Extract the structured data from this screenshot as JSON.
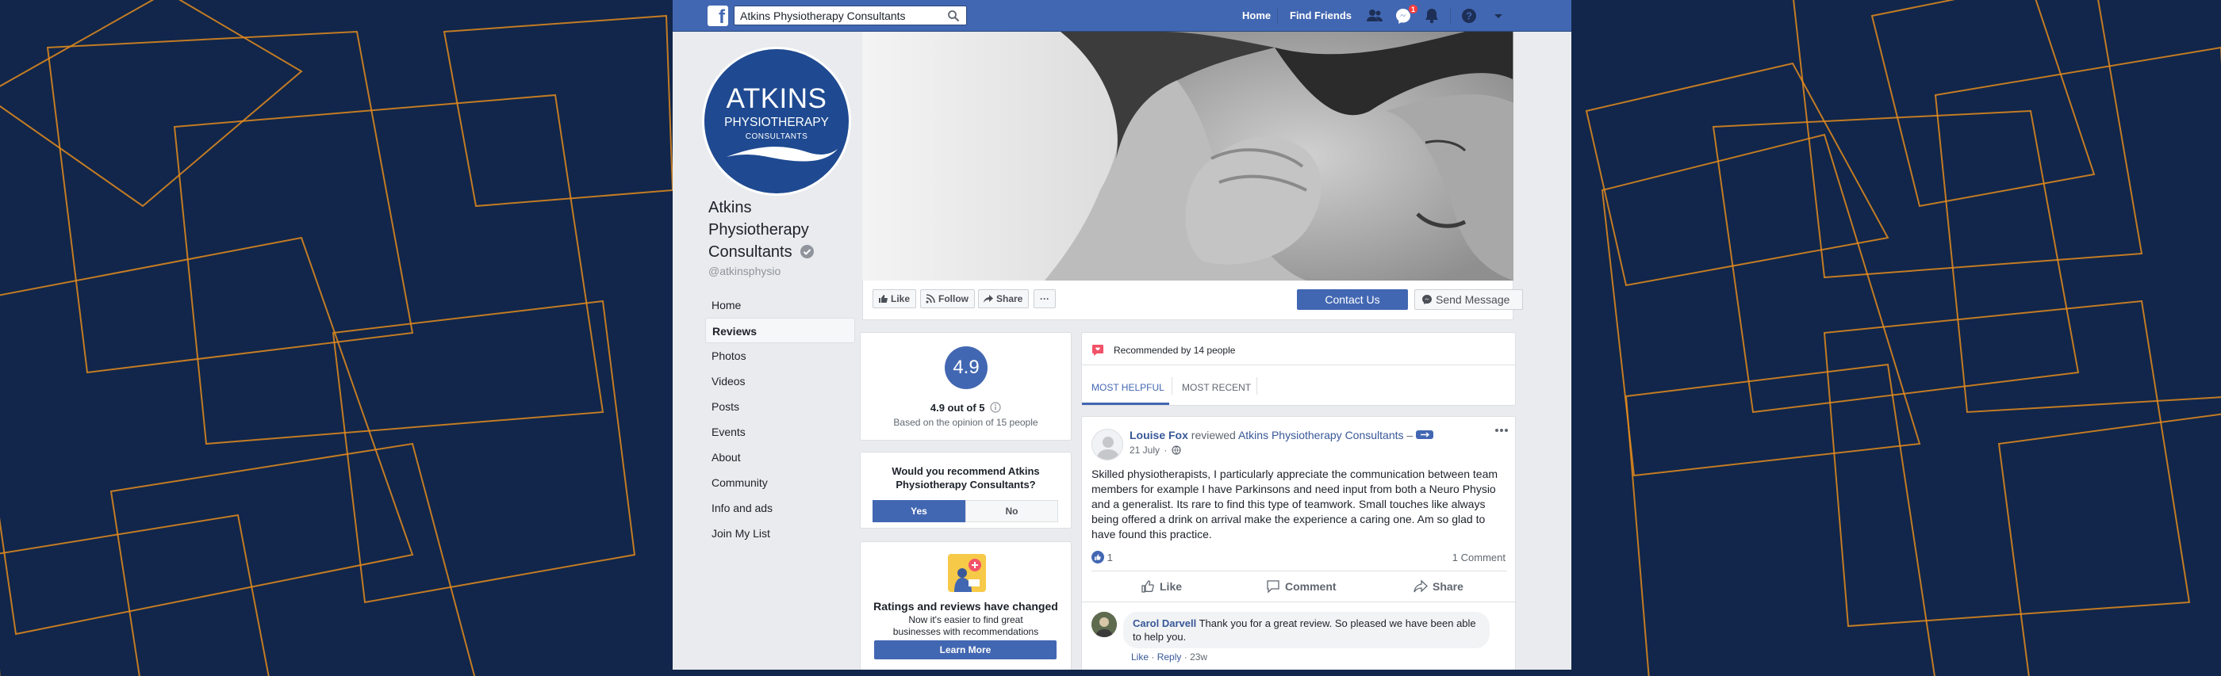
{
  "search": {
    "value": "Atkins Physiotherapy Consultants"
  },
  "topnav": {
    "home": "Home",
    "find_friends": "Find Friends",
    "notification_count": "1"
  },
  "profile": {
    "logo_line1": "ATKINS",
    "logo_line2": "PHYSIOTHERAPY",
    "logo_line3": "CONSULTANTS",
    "name": "Atkins Physiotherapy Consultants",
    "handle": "@atkinsphysio"
  },
  "sidebar": {
    "items": [
      {
        "label": "Home"
      },
      {
        "label": "Reviews"
      },
      {
        "label": "Photos"
      },
      {
        "label": "Videos"
      },
      {
        "label": "Posts"
      },
      {
        "label": "Events"
      },
      {
        "label": "About"
      },
      {
        "label": "Community"
      },
      {
        "label": "Info and ads"
      },
      {
        "label": "Join My List"
      }
    ]
  },
  "actions": {
    "like": "Like",
    "follow": "Follow",
    "share": "Share",
    "more": "···",
    "contact": "Contact Us",
    "message": "Send Message"
  },
  "rating": {
    "score": "4.9",
    "summary": "4.9 out of 5",
    "based_on": "Based on the opinion of 15 people"
  },
  "recommend": {
    "question": "Would you recommend Atkins Physiotherapy Consultants?",
    "yes": "Yes",
    "no": "No"
  },
  "ratings_changed": {
    "title": "Ratings and reviews have changed",
    "body": "Now it's easier to find great businesses with recommendations",
    "cta": "Learn More"
  },
  "reviews_header": {
    "recommended": "Recommended by 14 people",
    "tab_helpful": "MOST HELPFUL",
    "tab_recent": "MOST RECENT"
  },
  "review": {
    "author": "Louise Fox",
    "verb": "reviewed",
    "page": "Atkins Physiotherapy Consultants",
    "dash": "–",
    "date": "21 July",
    "text": "Skilled physiotherapists, I particularly appreciate the communication between team members for example I have Parkinsons and need input from both a Neuro Physio and a generalist. Its rare to find this type of teamwork. Small touches like always being offered a drink on arrival make the experience a caring one. Am so glad to have found this practice.",
    "like_count": "1",
    "comment_count": "1 Comment",
    "like_label": "Like",
    "comment_label": "Comment",
    "share_label": "Share"
  },
  "comment": {
    "author": "Carol Darvell",
    "text": "Thank you for a great review. So pleased we have been able to help you.",
    "like": "Like",
    "sep": "·",
    "reply": "Reply",
    "age": "23w"
  },
  "colors": {
    "background": "#11264a",
    "pattern": "#e38b1d",
    "facebook_blue": "#4267b2",
    "logo_blue": "#1f4a91"
  }
}
